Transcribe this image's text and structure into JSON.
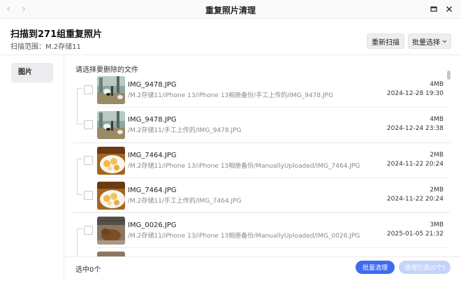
{
  "window": {
    "title": "重复照片清理"
  },
  "header": {
    "scan_title": "扫描到271组重复照片",
    "scan_range": "扫描范围：M.2存储11",
    "rescan_label": "重新扫描",
    "batch_select_label": "批量选择"
  },
  "sidebar": {
    "items": [
      {
        "label": "图片"
      }
    ]
  },
  "main": {
    "hint": "请选择要删除的文件",
    "files": [
      {
        "name": "IMG_9478.JPG",
        "path": "/M.2存储11/iPhone 13/iPhone 13相册备份/手工上传的/IMG_9478.JPG",
        "size": "4MB",
        "date": "2024-12-28 19:30",
        "thumb": "goats"
      },
      {
        "name": "IMG_9478.JPG",
        "path": "/M.2存储11/手工上传的/IMG_9478.JPG",
        "size": "4MB",
        "date": "2024-12-24 23:38",
        "thumb": "goats"
      },
      {
        "name": "IMG_7464.JPG",
        "path": "/M.2存储11/iPhone 13/iPhone 13相册备份/ManuallyUploaded/IMG_7464.JPG",
        "size": "2MB",
        "date": "2024-11-22 20:24",
        "thumb": "food"
      },
      {
        "name": "IMG_7464.JPG",
        "path": "/M.2存储11/手工上传的/IMG_7464.JPG",
        "size": "2MB",
        "date": "2024-11-22 20:24",
        "thumb": "food"
      },
      {
        "name": "IMG_0026.JPG",
        "path": "/M.2存储11/iPhone 13/iPhone 13相册备份/ManuallyUploaded/IMG_0026.JPG",
        "size": "3MB",
        "date": "2025-01-05 21:32",
        "thumb": "capybara"
      }
    ]
  },
  "footer": {
    "selected_count": "选中0个",
    "batch_clean_label": "批量清理",
    "clean_selected_label": "清理已选(0个)"
  },
  "colors": {
    "accent": "#3d6cf2",
    "accent_disabled": "#c4d3fb"
  }
}
